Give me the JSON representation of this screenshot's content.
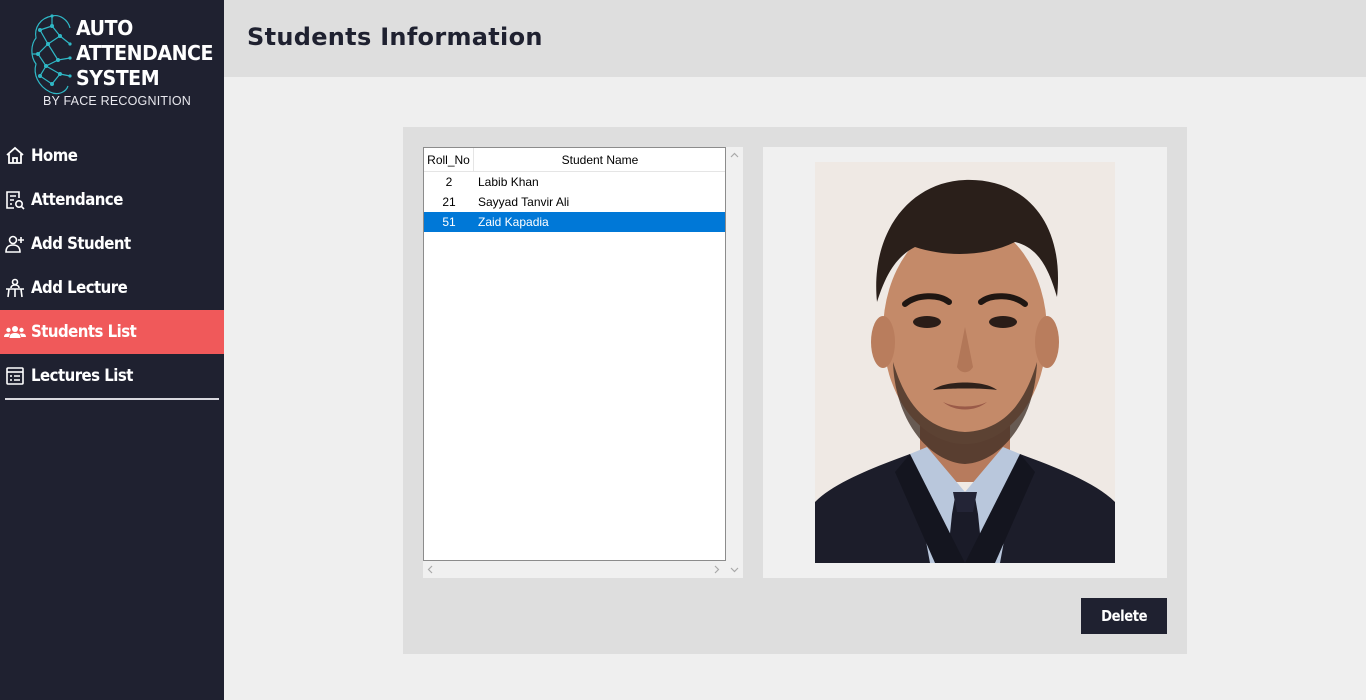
{
  "brand": {
    "line1": "AUTO",
    "line2": "ATTENDANCE",
    "line3": "SYSTEM",
    "subtitle": "BY FACE RECOGNITION"
  },
  "sidebar": {
    "items": [
      {
        "label": "Home",
        "icon": "home-icon",
        "active": false
      },
      {
        "label": "Attendance",
        "icon": "attendance-icon",
        "active": false
      },
      {
        "label": "Add Student",
        "icon": "add-user-icon",
        "active": false
      },
      {
        "label": "Add Lecture",
        "icon": "lecture-icon",
        "active": false
      },
      {
        "label": "Students List",
        "icon": "users-icon",
        "active": true
      },
      {
        "label": "Lectures List",
        "icon": "list-icon",
        "active": false
      }
    ]
  },
  "header": {
    "title": "Students Information"
  },
  "students_table": {
    "columns": [
      "Roll_No",
      "Student Name"
    ],
    "rows": [
      {
        "roll": "2",
        "name": "Labib Khan",
        "selected": false
      },
      {
        "roll": "21",
        "name": "Sayyad Tanvir Ali",
        "selected": false
      },
      {
        "roll": "51",
        "name": "Zaid Kapadia",
        "selected": true
      }
    ]
  },
  "actions": {
    "delete_label": "Delete"
  },
  "colors": {
    "sidebar_bg": "#1f2130",
    "active_item": "#f0595a",
    "selection": "#0078d7",
    "logo_accent": "#2fb8c6"
  }
}
